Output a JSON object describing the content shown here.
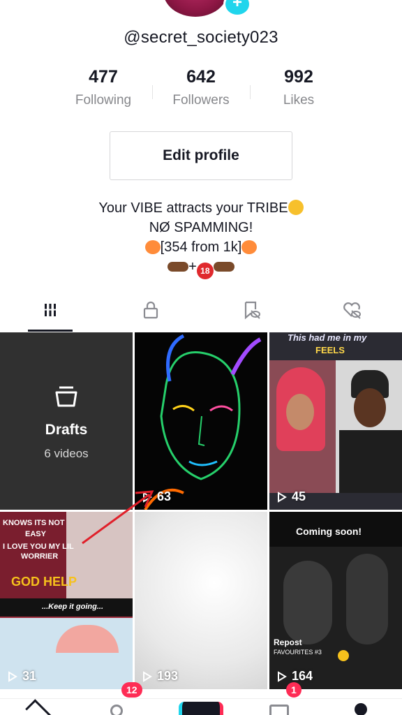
{
  "profile": {
    "username": "@secret_society023"
  },
  "stats": [
    {
      "value": "477",
      "label": "Following"
    },
    {
      "value": "642",
      "label": "Followers"
    },
    {
      "value": "992",
      "label": "Likes"
    }
  ],
  "actions": {
    "edit_profile": "Edit profile"
  },
  "bio": {
    "line1": "Your VIBE attracts your TRIBE",
    "line2": "NØ SPAMMING!",
    "line3": "[354 from 1k]",
    "line4_plus": "+",
    "line4_badge": "18"
  },
  "tabs": [
    {
      "name": "videos",
      "icon": "grid-icon",
      "active": true
    },
    {
      "name": "private",
      "icon": "lock-icon",
      "active": false
    },
    {
      "name": "favorites",
      "icon": "bookmark-eye-icon",
      "active": false
    },
    {
      "name": "liked",
      "icon": "heart-eye-icon",
      "active": false
    }
  ],
  "grid": {
    "drafts": {
      "title": "Drafts",
      "subtitle": "6 videos"
    },
    "videos": [
      {
        "views": "63"
      },
      {
        "views": "45",
        "caption_top": "This had me in my",
        "caption_sub": "FEELS"
      },
      {
        "views": "31",
        "caption_top": "KNOWS ITS NOT",
        "caption_2": "EASY",
        "caption_3": "I LOVE YOU MY LIL",
        "caption_4": "WORRIER",
        "caption_5": "GOD HELP",
        "caption_6": "...Keep it going..."
      },
      {
        "views": "193"
      },
      {
        "views": "164",
        "caption_top": "Coming soon!",
        "caption_repost": "Repost",
        "caption_fav": "FAVOURITES #3"
      }
    ]
  },
  "bottom_nav": {
    "inbox_badge": "12",
    "messages_badge": "1"
  },
  "colors": {
    "accent": "#fe2c55",
    "text": "#161823",
    "muted": "#86878b",
    "drafts_bg": "#303030"
  }
}
